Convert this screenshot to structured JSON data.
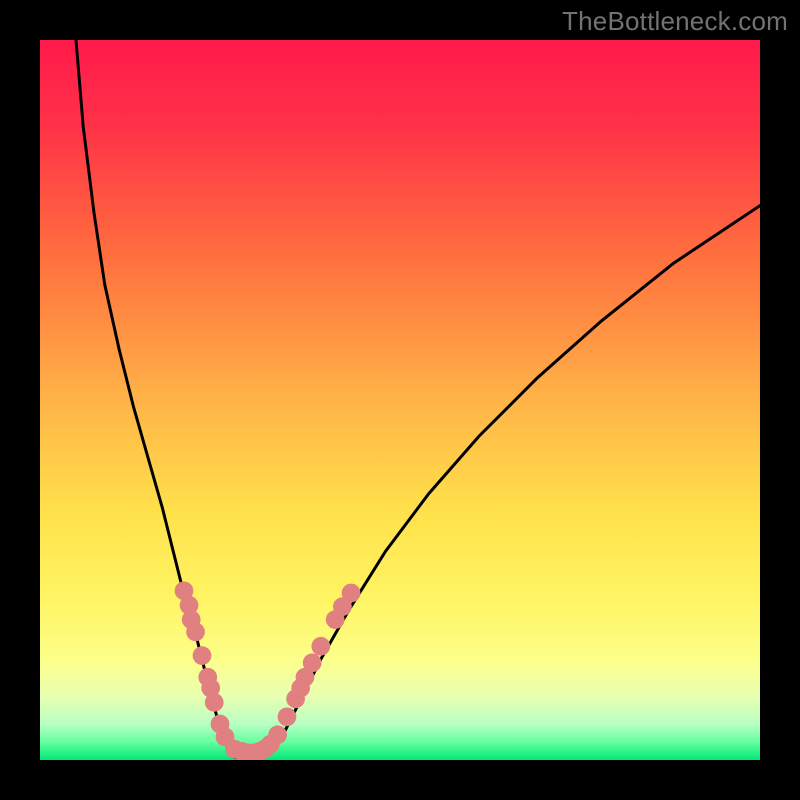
{
  "watermark": {
    "text": "TheBottleneck.com"
  },
  "chart_data": {
    "type": "line",
    "title": "",
    "xlabel": "",
    "ylabel": "",
    "xlim": [
      0,
      100
    ],
    "ylim": [
      0,
      100
    ],
    "grid": false,
    "legend": false,
    "gradient_stops": [
      {
        "pos": 0.0,
        "color": "#ff1a4b"
      },
      {
        "pos": 0.12,
        "color": "#ff3247"
      },
      {
        "pos": 0.3,
        "color": "#ff6f3e"
      },
      {
        "pos": 0.5,
        "color": "#ffb347"
      },
      {
        "pos": 0.66,
        "color": "#ffe24b"
      },
      {
        "pos": 0.78,
        "color": "#fff564"
      },
      {
        "pos": 0.86,
        "color": "#fdff8a"
      },
      {
        "pos": 0.91,
        "color": "#eaffb0"
      },
      {
        "pos": 0.95,
        "color": "#b8ffc4"
      },
      {
        "pos": 0.975,
        "color": "#66ff9e"
      },
      {
        "pos": 1.0,
        "color": "#00e878"
      }
    ],
    "series": [
      {
        "name": "left-branch",
        "x": [
          5,
          6,
          7.5,
          9,
          11,
          13,
          15,
          17,
          18.5,
          20,
          21.5,
          22.5,
          23.5,
          24.3,
          25,
          25.7,
          26.3,
          27
        ],
        "y": [
          100,
          88,
          76,
          66,
          57,
          49,
          42,
          35,
          29,
          23,
          18,
          14,
          10,
          7,
          4.5,
          2.5,
          1.2,
          0.4
        ]
      },
      {
        "name": "valley-floor",
        "x": [
          27,
          28,
          29,
          30,
          31,
          32
        ],
        "y": [
          0.4,
          0.2,
          0.2,
          0.3,
          0.5,
          1.0
        ]
      },
      {
        "name": "right-branch",
        "x": [
          32,
          34,
          36,
          39,
          43,
          48,
          54,
          61,
          69,
          78,
          88,
          100
        ],
        "y": [
          1.0,
          4,
          8,
          14,
          21,
          29,
          37,
          45,
          53,
          61,
          69,
          77
        ]
      }
    ],
    "dots": {
      "color": "#e08080",
      "radius": 1.3,
      "points": [
        {
          "x": 20.0,
          "y": 23.5
        },
        {
          "x": 20.7,
          "y": 21.5
        },
        {
          "x": 21.0,
          "y": 19.5
        },
        {
          "x": 21.6,
          "y": 17.8
        },
        {
          "x": 22.5,
          "y": 14.5
        },
        {
          "x": 23.3,
          "y": 11.5
        },
        {
          "x": 23.7,
          "y": 10.0
        },
        {
          "x": 24.2,
          "y": 8.0
        },
        {
          "x": 25.0,
          "y": 5.0
        },
        {
          "x": 25.7,
          "y": 3.2
        },
        {
          "x": 27.0,
          "y": 1.5
        },
        {
          "x": 28.0,
          "y": 1.2
        },
        {
          "x": 28.8,
          "y": 1.0
        },
        {
          "x": 29.7,
          "y": 1.0
        },
        {
          "x": 30.5,
          "y": 1.2
        },
        {
          "x": 31.3,
          "y": 1.6
        },
        {
          "x": 32.0,
          "y": 2.2
        },
        {
          "x": 33.0,
          "y": 3.5
        },
        {
          "x": 34.3,
          "y": 6.0
        },
        {
          "x": 35.5,
          "y": 8.5
        },
        {
          "x": 36.2,
          "y": 10.0
        },
        {
          "x": 36.8,
          "y": 11.5
        },
        {
          "x": 37.8,
          "y": 13.5
        },
        {
          "x": 39.0,
          "y": 15.8
        },
        {
          "x": 41.0,
          "y": 19.5
        },
        {
          "x": 42.0,
          "y": 21.3
        },
        {
          "x": 43.2,
          "y": 23.2
        }
      ]
    }
  }
}
